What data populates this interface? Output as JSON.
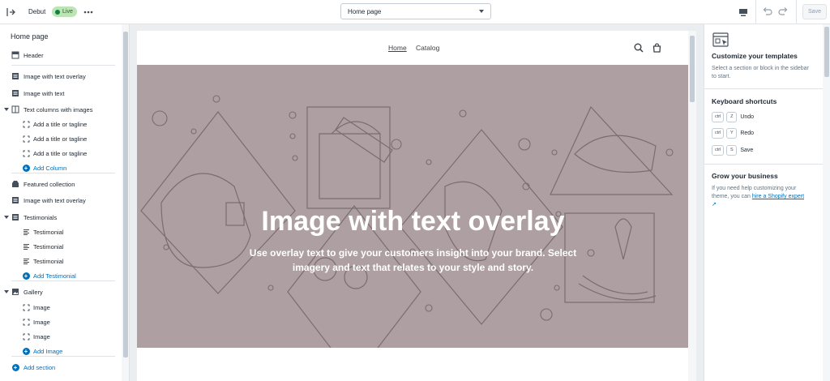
{
  "topbar": {
    "theme_name": "Debut",
    "status": "Live",
    "page_selector": "Home page",
    "save_label": "Save",
    "icons": [
      "exit-icon",
      "more-icon",
      "desktop-icon",
      "undo-icon",
      "redo-icon"
    ]
  },
  "sidebar": {
    "title": "Home page",
    "items": [
      {
        "label": "Header",
        "level": 0,
        "icon": "header-icon"
      },
      {
        "label": "Image with text overlay",
        "level": 0,
        "icon": "section-icon"
      },
      {
        "label": "Image with text",
        "level": 0,
        "icon": "section-icon"
      },
      {
        "label": "Text columns with images",
        "level": 0,
        "icon": "columns-icon",
        "expanded": true
      },
      {
        "label": "Add a title or tagline",
        "level": 1,
        "icon": "block-icon"
      },
      {
        "label": "Add a title or tagline",
        "level": 1,
        "icon": "block-icon"
      },
      {
        "label": "Add a title or tagline",
        "level": 1,
        "icon": "block-icon"
      },
      {
        "label": "Add Column",
        "level": 1,
        "icon": "add-icon"
      },
      {
        "label": "Featured collection",
        "level": 0,
        "icon": "collection-icon"
      },
      {
        "label": "Image with text overlay",
        "level": 0,
        "icon": "section-icon"
      },
      {
        "label": "Testimonials",
        "level": 0,
        "icon": "section-icon",
        "expanded": true
      },
      {
        "label": "Testimonial",
        "level": 1,
        "icon": "text-icon"
      },
      {
        "label": "Testimonial",
        "level": 1,
        "icon": "text-icon"
      },
      {
        "label": "Testimonial",
        "level": 1,
        "icon": "text-icon"
      },
      {
        "label": "Add Testimonial",
        "level": 1,
        "icon": "add-icon"
      },
      {
        "label": "Gallery",
        "level": 0,
        "icon": "gallery-icon",
        "expanded": true
      },
      {
        "label": "Image",
        "level": 1,
        "icon": "block-icon"
      },
      {
        "label": "Image",
        "level": 1,
        "icon": "block-icon"
      },
      {
        "label": "Image",
        "level": 1,
        "icon": "block-icon"
      },
      {
        "label": "Add Image",
        "level": 1,
        "icon": "add-icon"
      },
      {
        "label": "Add section",
        "level": 0,
        "icon": "add-icon"
      }
    ]
  },
  "preview": {
    "nav": {
      "home": "Home",
      "catalog": "Catalog"
    },
    "hero": {
      "title": "Image with text overlay",
      "subtitle": "Use overlay text to give your customers insight into your brand. Select imagery and text that relates to your style and story."
    }
  },
  "right_panel": {
    "customize_title": "Customize your templates",
    "customize_text": "Select a section or block in the sidebar to start.",
    "shortcuts_title": "Keyboard shortcuts",
    "shortcuts": [
      {
        "mod": "ctrl",
        "key": "Z",
        "label": "Undo"
      },
      {
        "mod": "ctrl",
        "key": "Y",
        "label": "Redo"
      },
      {
        "mod": "ctrl",
        "key": "S",
        "label": "Save"
      }
    ],
    "grow_title": "Grow your business",
    "grow_text": "If you need help customizing your theme, you can",
    "grow_link": "hire a Shopify expert"
  },
  "colors": {
    "accent": "#006fbb",
    "hero_bg": "#ae9fa2",
    "live_badge": "#bbe5b3"
  }
}
